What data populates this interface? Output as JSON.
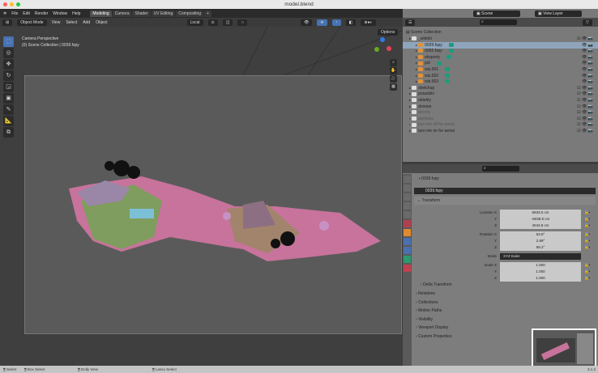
{
  "window": {
    "title": "model.blend"
  },
  "menu": [
    "File",
    "Edit",
    "Render",
    "Window",
    "Help"
  ],
  "workspaces": [
    {
      "label": "Modeling",
      "active": true
    },
    {
      "label": "Camera"
    },
    {
      "label": "Shader"
    },
    {
      "label": "UV Editing"
    },
    {
      "label": "Compositing"
    },
    {
      "label": "+"
    }
  ],
  "viewport": {
    "mode": "Object Mode",
    "menus": [
      "View",
      "Select",
      "Add",
      "Object"
    ],
    "orientation": "Local",
    "overlay_title": "Camera Perspective",
    "overlay_sub": "(0) Scene Collection | 0039.fspy",
    "options": "Options"
  },
  "scene": {
    "name": "Scene",
    "view_layer": "View Layer"
  },
  "outliner": {
    "root": "Scene Collection",
    "rows": [
      {
        "label": "_widoki",
        "level": 1,
        "type": "collection"
      },
      {
        "label": "0039.fspy",
        "level": 2,
        "selected": true
      },
      {
        "label": "0065.fspy",
        "level": 2
      },
      {
        "label": "eksporty",
        "level": 2
      },
      {
        "label": "pst",
        "level": 2
      },
      {
        "label": "wiz.001",
        "level": 2
      },
      {
        "label": "wiz.002",
        "level": 2
      },
      {
        "label": "wiz.003",
        "level": 2
      },
      {
        "label": "sketchup",
        "level": 1,
        "type": "collection"
      },
      {
        "label": "posadzki",
        "level": 1,
        "type": "collection"
      },
      {
        "label": "obiekty",
        "level": 1,
        "type": "collection"
      },
      {
        "label": "drzewa",
        "level": 1,
        "type": "collection"
      },
      {
        "label": "korony",
        "level": 1,
        "type": "collection",
        "dim": true
      },
      {
        "label": "particles",
        "level": 1,
        "type": "collection",
        "dim": true
      },
      {
        "label": "turn me off for aerial",
        "level": 1,
        "type": "collection",
        "dim": true
      },
      {
        "label": "turn me on for aerial",
        "level": 1,
        "type": "collection"
      }
    ]
  },
  "properties": {
    "object": "0039.fspy",
    "name_field": "0039.fspy",
    "transform": "Transform",
    "location": {
      "label": "Location X",
      "x": "6933.0 cm",
      "y": "-6038.8 cm",
      "z": "4043.8 cm"
    },
    "rotation": {
      "label": "Rotation X",
      "x": "63.8°",
      "y": "2.89°",
      "z": "58.2°"
    },
    "mode_label": "Mode",
    "mode": "XYZ Euler",
    "scale": {
      "label": "Scale X",
      "x": "1.000",
      "y": "1.000",
      "z": "1.000"
    },
    "axis": {
      "y": "Y",
      "z": "Z"
    },
    "sections": [
      "Delta Transform",
      "Relations",
      "Collections",
      "Motion Paths",
      "Visibility",
      "Viewport Display",
      "Custom Properties"
    ]
  },
  "statusbar": {
    "select": "Select",
    "box_select": "Box Select",
    "dolly": "Dolly View",
    "lasso": "Lasso Select",
    "version": "3.1.2"
  },
  "colors": {
    "accent": "#4772b3",
    "selection": "#8ea5bc"
  }
}
